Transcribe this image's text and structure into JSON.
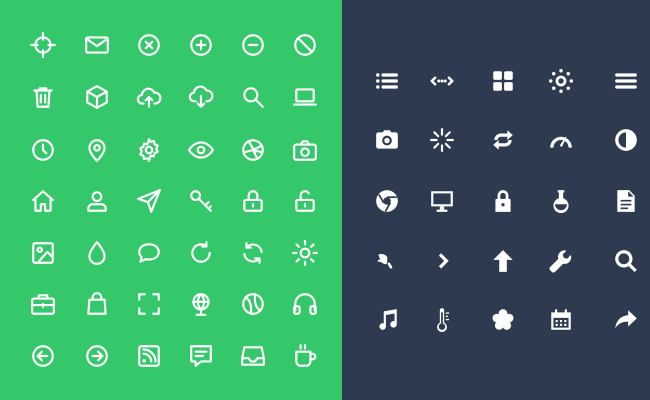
{
  "colors": {
    "left_background": "#35c86a",
    "right_background": "#2e3a50",
    "icon": "#ffffff"
  },
  "left_icons": [
    [
      "crosshair-icon",
      "mail-icon",
      "close-circle-icon",
      "plus-circle-icon",
      "minus-circle-icon",
      "block-icon"
    ],
    [
      "trash-icon",
      "box-icon",
      "cloud-upload-icon",
      "cloud-download-icon",
      "search-icon",
      "laptop-icon"
    ],
    [
      "clock-icon",
      "map-pin-icon",
      "gear-icon",
      "eye-icon",
      "aperture-icon",
      "camera-icon"
    ],
    [
      "home-icon",
      "user-icon",
      "send-icon",
      "key-icon",
      "lock-icon",
      "unlock-icon"
    ],
    [
      "image-icon",
      "droplet-icon",
      "chat-bubble-icon",
      "refresh-icon",
      "sync-icon",
      "sun-icon"
    ],
    [
      "briefcase-icon",
      "shopping-bag-icon",
      "fullscreen-icon",
      "globe-icon",
      "ball-icon",
      "headphones-icon"
    ],
    [
      "arrow-left-circle-icon",
      "arrow-right-circle-icon",
      "rss-icon",
      "message-icon",
      "inbox-icon",
      "coffee-icon"
    ]
  ],
  "right_icons": [
    [
      "list-icon",
      "ellipsis-arrows-icon",
      "grid-icon",
      "loading-sun-icon",
      "menu-icon"
    ],
    [
      "camera-icon",
      "spinner-icon",
      "repeat-icon",
      "dashboard-icon",
      "contrast-icon"
    ],
    [
      "chrome-icon",
      "monitor-icon",
      "padlock-icon",
      "flask-icon",
      "document-icon"
    ],
    [
      "ice-cream-icon",
      "chevron-right-icon",
      "arrow-up-icon",
      "wrench-icon",
      "magnify-icon"
    ],
    [
      "music-note-icon",
      "thermometer-icon",
      "asterisk-icon",
      "calendar-icon",
      "share-arrow-icon"
    ]
  ]
}
